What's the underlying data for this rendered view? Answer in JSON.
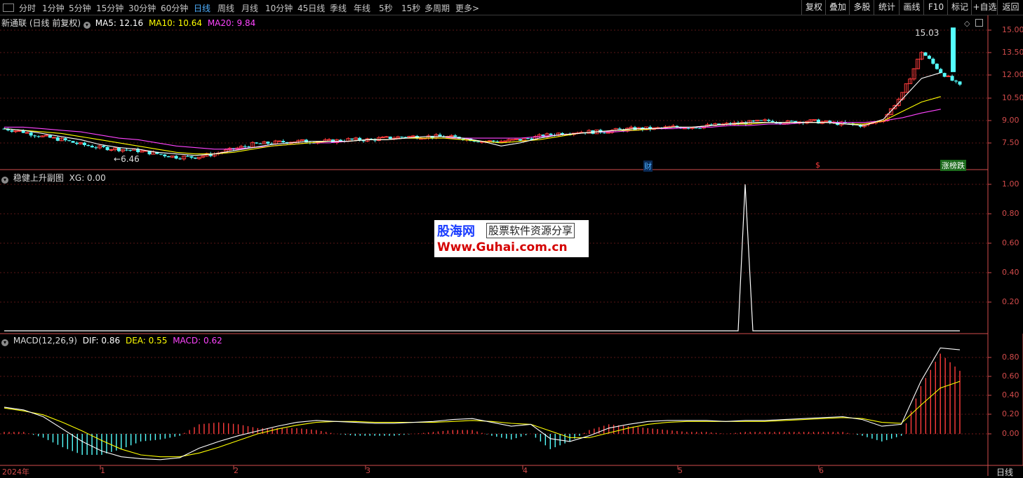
{
  "toolbar": {
    "periods": [
      "分时",
      "1分钟",
      "5分钟",
      "15分钟",
      "30分钟",
      "60分钟",
      "日线",
      "周线",
      "月线",
      "10分钟",
      "45日线",
      "季线",
      "年线",
      "5秒",
      "15秒",
      "多周期",
      "更多>"
    ],
    "active_period": "日线",
    "buttons": [
      "复权",
      "叠加",
      "多股",
      "统计",
      "画线",
      "F10",
      "标记",
      "+自选",
      "返回"
    ]
  },
  "price_pane": {
    "stock": "新通联",
    "mode": "(日线 前复权)",
    "ma5": "MA5: 12.16",
    "ma10": "MA10: 10.64",
    "ma20": "MA20: 9.84",
    "high_label": "15.03",
    "low_label": "6.46",
    "marker_cai": "财",
    "marker_s": "$",
    "marker_zb": "涨榜跌",
    "y_ticks": [
      "15.00",
      "13.50",
      "12.00",
      "10.50",
      "9.00",
      "7.50"
    ]
  },
  "indicator_pane": {
    "title": "稳健上升副图",
    "value": "XG: 0.00",
    "y_ticks": [
      "1.00",
      "0.80",
      "0.60",
      "0.40",
      "0.20"
    ]
  },
  "macd_pane": {
    "title": "MACD(12,26,9)",
    "dif": "DIF: 0.86",
    "dea": "DEA: 0.55",
    "macd": "MACD: 0.62",
    "y_ticks": [
      "0.80",
      "0.60",
      "0.40",
      "0.20",
      "0.00"
    ]
  },
  "x_axis": {
    "labels": [
      "2024年",
      "1",
      "2",
      "3",
      "4",
      "5",
      "6"
    ],
    "period_label": "日线"
  },
  "watermark": {
    "brand": "股海网",
    "slogan": "股票软件资源分享",
    "url": "Www.Guhai.com.cn"
  },
  "colors": {
    "up": "#ff3c3c",
    "down": "#54ffff",
    "ma5": "#ffffff",
    "ma10": "#ffff00",
    "ma20": "#ff44ff",
    "axis": "#d24b4b",
    "grid": "#5a1616",
    "active": "#4fb0ff"
  },
  "chart_data": [
    {
      "type": "candlestick",
      "title": "新通联 (日线 前复权)",
      "ylim": [
        6.0,
        15.8
      ],
      "approx_close": [
        8.6,
        8.4,
        8.1,
        7.9,
        7.6,
        7.4,
        7.3,
        7.2,
        7.0,
        6.8,
        6.8,
        7.0,
        7.3,
        7.6,
        7.7,
        7.8,
        7.8,
        7.8,
        7.9,
        7.9,
        8.0,
        8.1,
        8.1,
        8.1,
        8.0,
        7.8,
        7.8,
        7.9,
        8.1,
        8.3,
        8.4,
        8.4,
        8.5,
        8.6,
        8.6,
        8.7,
        8.7,
        8.8,
        8.9,
        9.0,
        9.1,
        9.0,
        9.1,
        9.0,
        8.9,
        8.8,
        9.2,
        10.8,
        13.5,
        12.2,
        11.3
      ],
      "ma5": [
        8.6,
        8.5,
        8.3,
        8.1,
        7.9,
        7.6,
        7.4,
        7.3,
        7.1,
        7.0,
        6.9,
        7.0,
        7.2,
        7.4,
        7.6,
        7.7,
        7.8,
        7.8,
        7.8,
        7.9,
        7.9,
        8.0,
        8.1,
        8.1,
        8.0,
        7.8,
        7.5,
        7.7,
        8.0,
        8.2,
        8.3,
        8.4,
        8.5,
        8.6,
        8.6,
        8.7,
        8.7,
        8.8,
        8.9,
        9.0,
        9.0,
        9.0,
        9.0,
        9.0,
        8.9,
        8.8,
        9.2,
        10.5,
        11.8,
        12.16
      ],
      "ma10": [
        8.6,
        8.5,
        8.4,
        8.3,
        8.1,
        7.9,
        7.7,
        7.5,
        7.3,
        7.1,
        7.0,
        7.0,
        7.1,
        7.3,
        7.5,
        7.6,
        7.7,
        7.8,
        7.8,
        7.9,
        7.9,
        8.0,
        8.0,
        8.0,
        7.9,
        7.8,
        7.7,
        7.8,
        7.9,
        8.1,
        8.3,
        8.4,
        8.5,
        8.5,
        8.6,
        8.7,
        8.7,
        8.8,
        8.9,
        8.9,
        9.0,
        9.0,
        9.0,
        9.0,
        8.9,
        8.9,
        9.1,
        9.7,
        10.3,
        10.64
      ],
      "ma20": [
        8.7,
        8.7,
        8.6,
        8.5,
        8.4,
        8.2,
        8.0,
        7.9,
        7.7,
        7.5,
        7.4,
        7.3,
        7.3,
        7.4,
        7.5,
        7.6,
        7.7,
        7.7,
        7.8,
        7.9,
        7.9,
        8.0,
        8.0,
        8.0,
        8.0,
        8.0,
        8.0,
        8.0,
        8.1,
        8.2,
        8.3,
        8.4,
        8.4,
        8.5,
        8.6,
        8.6,
        8.7,
        8.7,
        8.8,
        8.8,
        8.9,
        8.9,
        9.0,
        9.0,
        9.0,
        9.0,
        9.1,
        9.3,
        9.6,
        9.84
      ]
    },
    {
      "type": "line",
      "title": "稳健上升副图",
      "ylim": [
        0,
        1.0
      ],
      "note_spike_at": "early May",
      "values_peak": 1.0
    },
    {
      "type": "line",
      "title": "MACD(12,26,9)",
      "ylim": [
        -0.3,
        0.95
      ],
      "dif": [
        0.28,
        0.25,
        0.18,
        0.05,
        -0.08,
        -0.18,
        -0.24,
        -0.26,
        -0.27,
        -0.25,
        -0.15,
        -0.08,
        -0.02,
        0.03,
        0.08,
        0.12,
        0.14,
        0.13,
        0.12,
        0.11,
        0.11,
        0.12,
        0.13,
        0.15,
        0.16,
        0.12,
        0.08,
        0.1,
        -0.05,
        -0.08,
        -0.02,
        0.06,
        0.1,
        0.13,
        0.14,
        0.14,
        0.14,
        0.13,
        0.14,
        0.14,
        0.15,
        0.16,
        0.17,
        0.18,
        0.15,
        0.08,
        0.1,
        0.55,
        0.9,
        0.88
      ],
      "dea": [
        0.27,
        0.24,
        0.2,
        0.12,
        0.03,
        -0.07,
        -0.16,
        -0.22,
        -0.24,
        -0.24,
        -0.2,
        -0.14,
        -0.07,
        0.0,
        0.05,
        0.09,
        0.12,
        0.13,
        0.13,
        0.12,
        0.12,
        0.12,
        0.12,
        0.13,
        0.14,
        0.13,
        0.11,
        0.1,
        0.03,
        -0.04,
        -0.04,
        0.01,
        0.06,
        0.1,
        0.12,
        0.13,
        0.13,
        0.13,
        0.13,
        0.13,
        0.14,
        0.15,
        0.16,
        0.17,
        0.16,
        0.12,
        0.11,
        0.3,
        0.48,
        0.55
      ]
    }
  ]
}
